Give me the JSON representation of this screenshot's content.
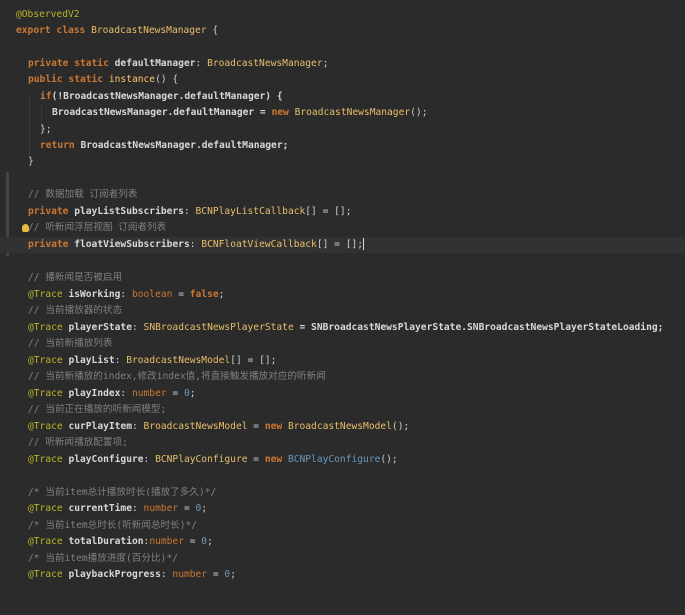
{
  "lines": {
    "l1": "@ObservedV2",
    "l2a": "export class ",
    "l2b": "BroadcastNewsManager",
    "l2c": " {",
    "l3a": "private static ",
    "l3b": "defaultManager",
    "l3c": ": ",
    "l3d": "BroadcastNewsManager",
    "l3e": ";",
    "l4a": "public static ",
    "l4b": "instance",
    "l4c": "() {",
    "l5a": "if",
    "l5b": "(!BroadcastNewsManager.defaultManager) {",
    "l6a": "BroadcastNewsManager.defaultManager = ",
    "l6b": "new ",
    "l6c": "BroadcastNewsManager",
    "l6d": "();",
    "l7": "};",
    "l8a": "return ",
    "l8b": "BroadcastNewsManager.defaultManager;",
    "l9": "}",
    "c1": "// 数据加载 订阅者列表",
    "l10a": "private ",
    "l10b": "playListSubscribers",
    "l10c": ": ",
    "l10d": "BCNPlayListCallback",
    "l10e": "[] = [];",
    "c2": "// 听新闻浮层视图 订阅者列表",
    "l11a": "private ",
    "l11b": "floatViewSubscribers",
    "l11c": ": ",
    "l11d": "BCNFloatViewCallback",
    "l11e": "[] = [];",
    "c3": "// 播新闻是否被启用",
    "l12a": "@Trace ",
    "l12b": "isWorking",
    "l12c": ": ",
    "l12d": "boolean",
    "l12e": " = ",
    "l12f": "false",
    "l12g": ";",
    "c4": "// 当前播放器的状态",
    "l13a": "@Trace ",
    "l13b": "playerState",
    "l13c": ": ",
    "l13d": "SNBroadcastNewsPlayerState",
    "l13e": " = SNBroadcastNewsPlayerState.SNBroadcastNewsPlayerStateLoading;",
    "c5": "// 当前新播放列表",
    "l14a": "@Trace ",
    "l14b": "playList",
    "l14c": ": ",
    "l14d": "BroadcastNewsModel",
    "l14e": "[] = [];",
    "c6": "// 当前新播放的index,修改index值,将直接触发播放对应的听新闻",
    "l15a": "@Trace ",
    "l15b": "playIndex",
    "l15c": ": ",
    "l15d": "number",
    "l15e": " = ",
    "l15f": "0",
    "l15g": ";",
    "c7": "// 当前正在播放的听新闻模型;",
    "l16a": "@Trace ",
    "l16b": "curPlayItem",
    "l16c": ": ",
    "l16d": "BroadcastNewsModel",
    "l16e": " = ",
    "l16f": "new ",
    "l16g": "BroadcastNewsModel",
    "l16h": "();",
    "c8": "// 听新闻播放配置项;",
    "l17a": "@Trace ",
    "l17b": "playConfigure",
    "l17c": ": ",
    "l17d": "BCNPlayConfigure",
    "l17e": " = ",
    "l17f": "new ",
    "l17g": "BCNPlayConfigure",
    "l17h": "();",
    "c9": "/* 当前item总计播放时长(播放了多久)*/",
    "l18a": "@Trace ",
    "l18b": "currentTime",
    "l18c": ": ",
    "l18d": "number",
    "l18e": " = ",
    "l18f": "0",
    "l18g": ";",
    "c10": "/* 当前item总时长(听新闻总时长)*/",
    "l19a": "@Trace ",
    "l19b": "totalDuration",
    "l19c": ":",
    "l19d": "number",
    "l19e": " = ",
    "l19f": "0",
    "l19g": ";",
    "c11": "/* 当前item播放进度(百分比)*/",
    "l20a": "@Trace ",
    "l20b": "playbackProgress",
    "l20c": ": ",
    "l20d": "number",
    "l20e": " = ",
    "l20f": "0",
    "l20g": ";"
  },
  "colors": {
    "background": "#2b2b2b",
    "keyword": "#cc7832",
    "type": "#6897bb",
    "class": "#e8bf6a",
    "comment": "#808080",
    "decorator": "#bbb529"
  },
  "icons": {
    "intention": "lightbulb-icon"
  }
}
